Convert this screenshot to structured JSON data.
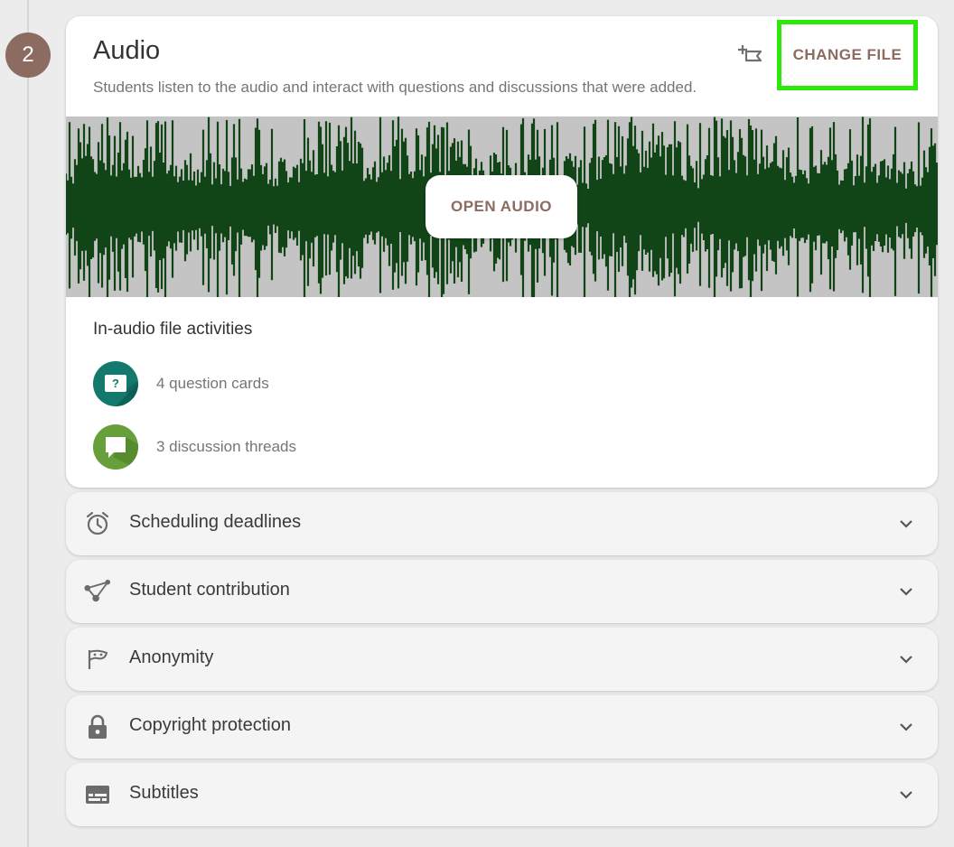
{
  "step": {
    "number": "2"
  },
  "card": {
    "title": "Audio",
    "description": "Students listen to the audio and interact with questions and discussions that were added.",
    "change_file_label": "CHANGE FILE",
    "open_audio_label": "OPEN AUDIO",
    "activities_heading": "In-audio file activities",
    "activities": [
      {
        "label": "4 question cards",
        "icon": "question-card-icon",
        "color": "#12796c"
      },
      {
        "label": "3 discussion threads",
        "icon": "discussion-bubble-icon",
        "color": "#67a03a"
      }
    ]
  },
  "accordions": [
    {
      "label": "Scheduling deadlines",
      "icon": "alarm-clock-icon"
    },
    {
      "label": "Student contribution",
      "icon": "share-network-icon"
    },
    {
      "label": "Anonymity",
      "icon": "mask-icon"
    },
    {
      "label": "Copyright protection",
      "icon": "lock-icon"
    },
    {
      "label": "Subtitles",
      "icon": "subtitles-icon"
    }
  ],
  "colors": {
    "accent": "#8c6b60",
    "highlight": "#2ee80c",
    "waveform": "#114517",
    "waveform_bg": "#c4c4c4"
  }
}
